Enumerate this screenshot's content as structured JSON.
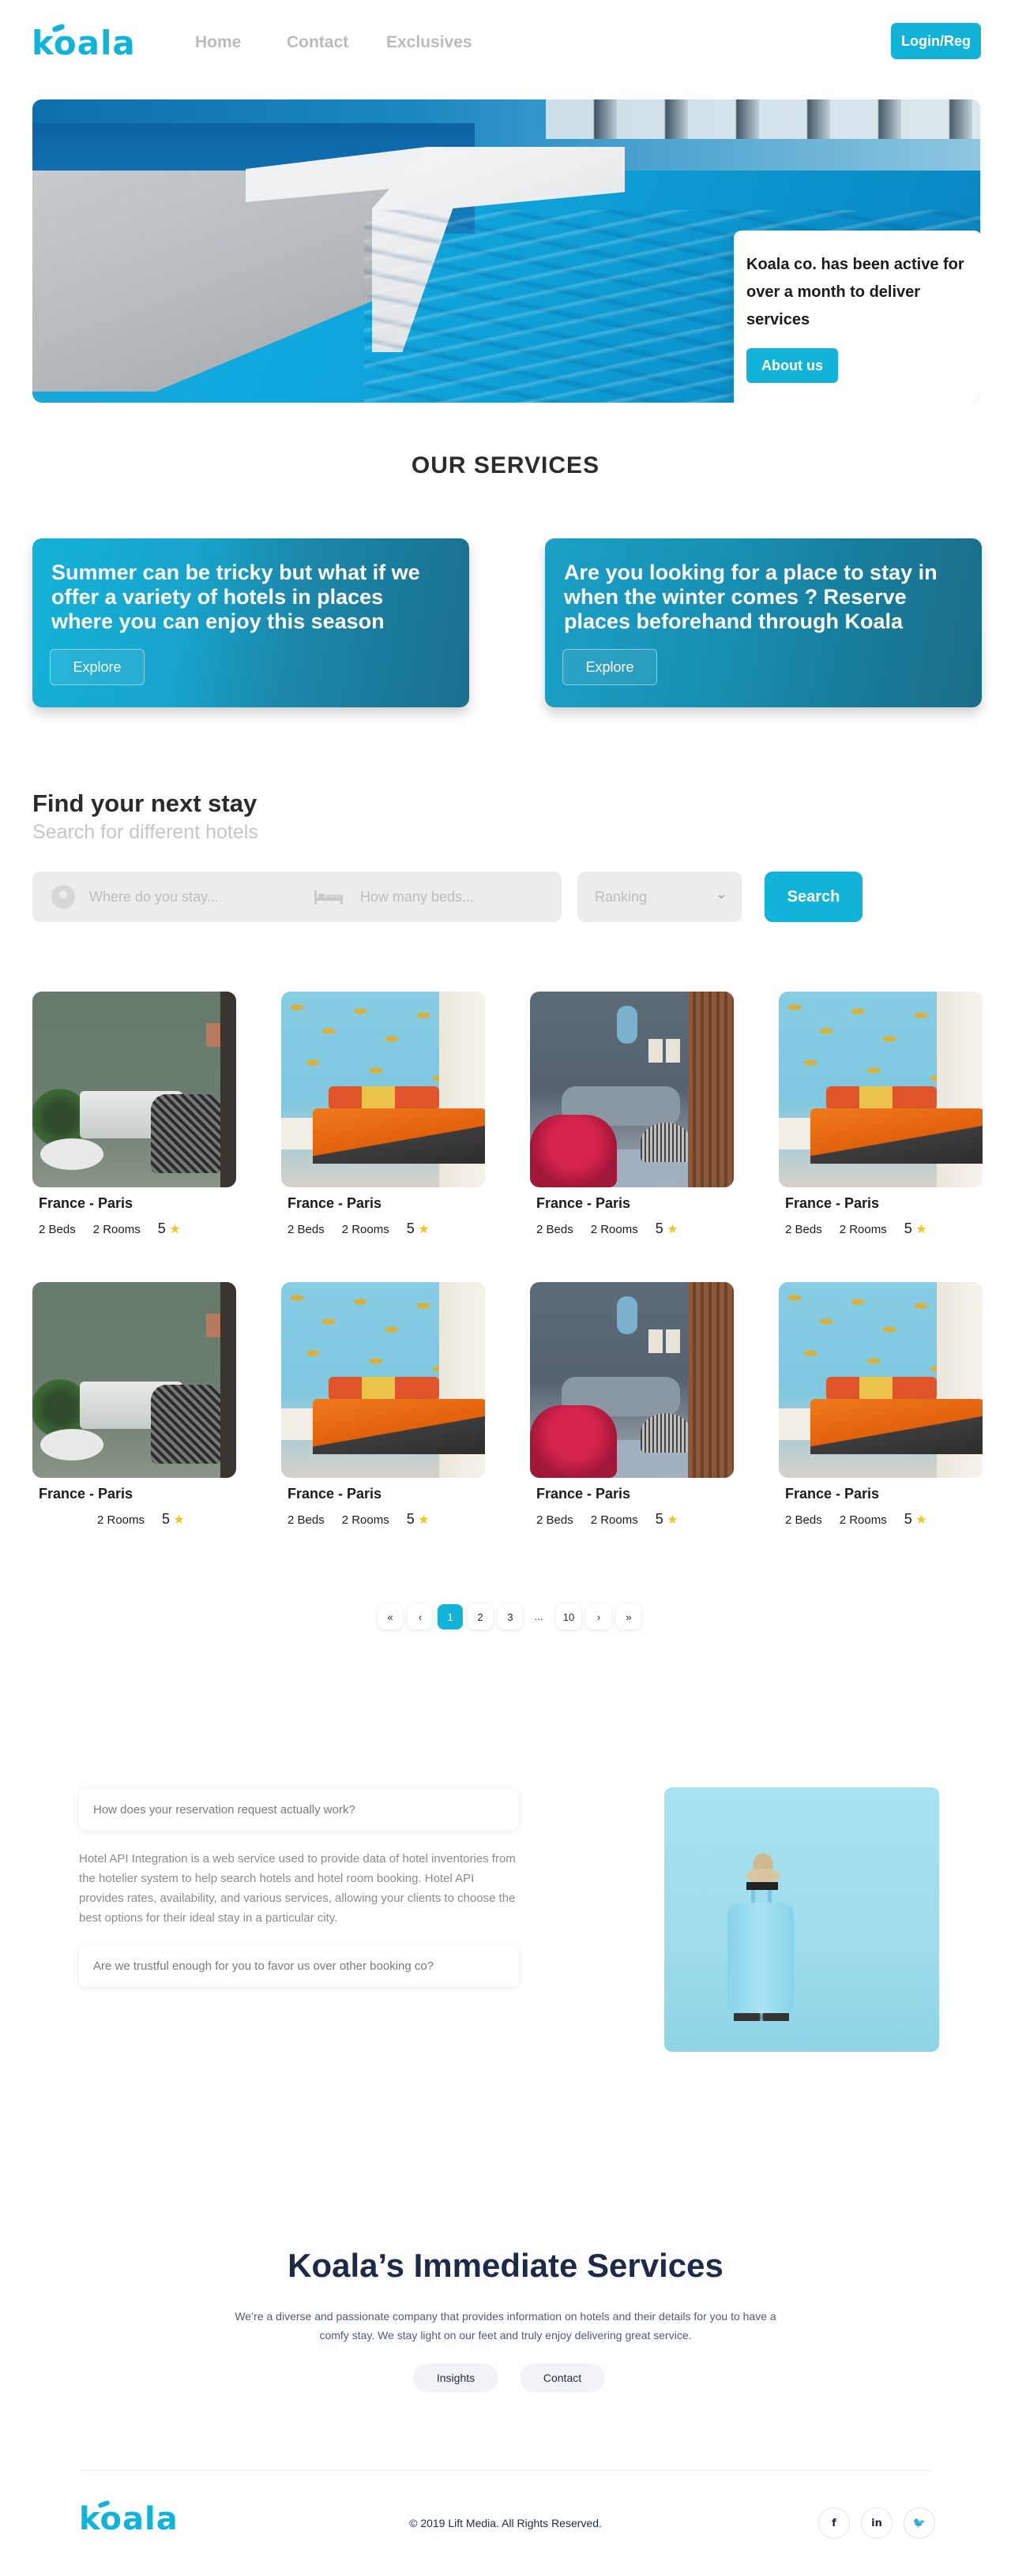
{
  "brand": {
    "logo_text": "koala",
    "accent_color": "#12b3d9"
  },
  "nav": {
    "links": [
      "Home",
      "Contact",
      "Exclusives"
    ],
    "login_label": "Login/Reg"
  },
  "hero": {
    "card_text": "Koala co. has been active for over a month to deliver services",
    "about_label": "About us"
  },
  "services": {
    "title": "OUR SERVICES",
    "cards": [
      {
        "text": "Summer can be tricky but what if we offer a variety of hotels in places where you can enjoy this season",
        "button": "Explore"
      },
      {
        "text": "Are you looking for a place to stay in when the winter comes ? Reserve places beforehand through Koala",
        "button": "Explore"
      }
    ]
  },
  "search": {
    "title": "Find your next stay",
    "subtitle": "Search for different hotels",
    "location_placeholder": "Where do you stay...",
    "beds_placeholder": "How many beds...",
    "ranking_label": "Ranking",
    "search_label": "Search"
  },
  "hotels": [
    {
      "place": "France - Paris",
      "beds": "2 Beds",
      "rooms": "2 Rooms",
      "rating": "5",
      "room": "green"
    },
    {
      "place": "France - Paris",
      "beds": "2 Beds",
      "rooms": "2 Rooms",
      "rating": "5",
      "room": "blue"
    },
    {
      "place": "France - Paris",
      "beds": "2 Beds",
      "rooms": "2 Rooms",
      "rating": "5",
      "room": "grey"
    },
    {
      "place": "France - Paris",
      "beds": "2 Beds",
      "rooms": "2 Rooms",
      "rating": "5",
      "room": "blue"
    },
    {
      "place": "France - Paris",
      "beds": "",
      "rooms": "2 Rooms",
      "rating": "5",
      "room": "green"
    },
    {
      "place": "France - Paris",
      "beds": "2 Beds",
      "rooms": "2 Rooms",
      "rating": "5",
      "room": "blue"
    },
    {
      "place": "France - Paris",
      "beds": "2 Beds",
      "rooms": "2 Rooms",
      "rating": "5",
      "room": "grey"
    },
    {
      "place": "France - Paris",
      "beds": "2 Beds",
      "rooms": "2 Rooms",
      "rating": "5",
      "room": "blue"
    }
  ],
  "pagination": {
    "first": "«",
    "prev": "‹",
    "pages": [
      "1",
      "2",
      "3",
      "...",
      "10"
    ],
    "current": "1",
    "next": "›",
    "last": "»"
  },
  "faq": {
    "q1": "How does your reservation request actually work?",
    "a1": "Hotel API Integration is a web service used to provide data of hotel inventories from the hotelier system to help search hotels and hotel room booking. Hotel API provides rates, availability, and various services, allowing your clients to choose the best options for their ideal stay in a particular city.",
    "q2": "Are we trustful enough for you to favor us over other booking co?"
  },
  "immediate": {
    "title": "Koala’s Immediate Services",
    "description": "We’re a diverse and passionate company that provides information on hotels and their details for you to have a comfy stay. We stay light on our feet and truly enjoy delivering great service.",
    "buttons": [
      "Insights",
      "Contact"
    ]
  },
  "footer": {
    "copyright": "© 2019 Lift Media. All Rights Reserved.",
    "social": [
      {
        "icon": "facebook-icon",
        "glyph": "f"
      },
      {
        "icon": "linkedin-icon",
        "glyph": "in"
      },
      {
        "icon": "twitter-icon",
        "glyph": "🐦"
      }
    ]
  }
}
